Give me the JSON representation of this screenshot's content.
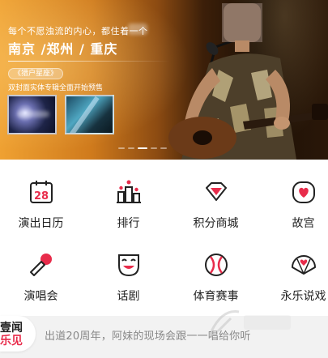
{
  "banner": {
    "tagline": "每个不愿浊流的内心，都住着一个",
    "cities": "南京 /郑州 / 重庆",
    "album_title": "《猎户星座》",
    "album_desc": "双封面实体专辑全面开始预售"
  },
  "menu": {
    "row1": [
      {
        "label": "演出日历",
        "icon": "calendar-28-icon",
        "calendar_day": "28"
      },
      {
        "label": "排行",
        "icon": "ranking-podium-icon"
      },
      {
        "label": "积分商城",
        "icon": "diamond-shop-icon"
      },
      {
        "label": "故宫",
        "icon": "heart-palace-icon"
      }
    ],
    "row2": [
      {
        "label": "演唱会",
        "icon": "microphone-icon"
      },
      {
        "label": "话剧",
        "icon": "drama-mask-icon"
      },
      {
        "label": "体育赛事",
        "icon": "baseball-icon"
      },
      {
        "label": "永乐说戏",
        "icon": "opera-fan-icon"
      }
    ]
  },
  "news": {
    "logo_top": "壹闻",
    "logo_bottom": "乐见",
    "headline": "出道20周年，阿妹的现场会跟一一唱给你听"
  },
  "colors": {
    "accent": "#e82c4b",
    "banner_orange": "#efa132"
  }
}
